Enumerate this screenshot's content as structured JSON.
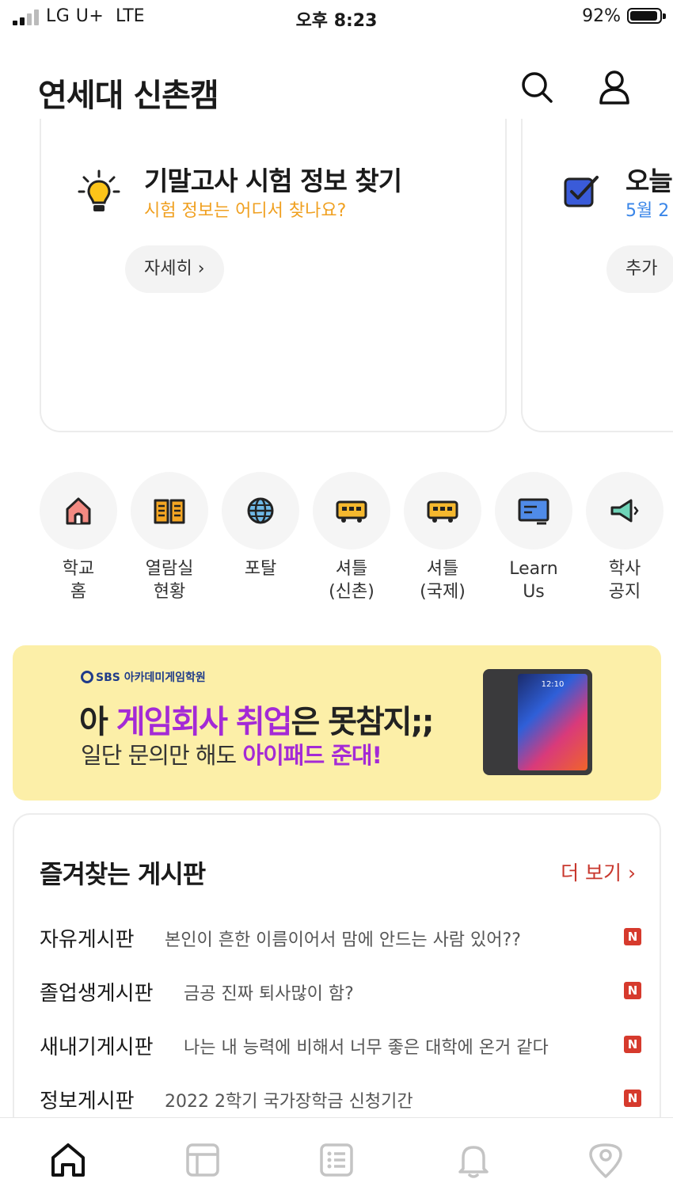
{
  "status_bar": {
    "carrier": "LG U+",
    "network": "LTE",
    "time": "오후 8:23",
    "battery": "92%"
  },
  "header": {
    "title": "연세대 신촌캠"
  },
  "cards": [
    {
      "icon": "lightbulb-icon",
      "title": "기말고사 시험 정보 찾기",
      "subtitle": "시험 정보는 어디서 찾나요?",
      "button": "자세히 ›",
      "subtitle_color": "#f0a020"
    },
    {
      "icon": "checkbox-icon",
      "title": "오늘",
      "subtitle": "5월 2",
      "button": "추가",
      "subtitle_color": "#3a86e8"
    }
  ],
  "quick_menu": [
    {
      "label": "학교\n홈",
      "icon": "house-icon"
    },
    {
      "label": "열람실\n현황",
      "icon": "book-icon"
    },
    {
      "label": "포탈",
      "icon": "globe-icon"
    },
    {
      "label": "셔틀\n(신촌)",
      "icon": "bus-icon"
    },
    {
      "label": "셔틀\n(국제)",
      "icon": "bus-icon"
    },
    {
      "label": "Learn\nUs",
      "icon": "board-icon"
    },
    {
      "label": "학사\n공지",
      "icon": "megaphone-icon"
    }
  ],
  "banner": {
    "logo": "SBS 아카데미게임학원",
    "line1_a": "아 ",
    "line1_hl": "게임회사 취업",
    "line1_b": "은 못참지;;",
    "line2_a": "일단 문의만 해도 ",
    "line2_hl": "아이패드 준대!",
    "device_time": "12:10"
  },
  "favorites": {
    "title": "즐겨찾는 게시판",
    "more": "더 보기 ›",
    "new_badge": "N",
    "rows": [
      {
        "board": "자유게시판",
        "post": "본인이 흔한 이름이어서 맘에 안드는 사람 있어??"
      },
      {
        "board": "졸업생게시판",
        "post": "금공 진짜 퇴사많이 함?"
      },
      {
        "board": "새내기게시판",
        "post": "나는 내 능력에 비해서 너무 좋은 대학에 온거 같다"
      },
      {
        "board": "정보게시판",
        "post": "2022 2학기 국가장학금 신청기간"
      }
    ]
  },
  "tab_bar": [
    {
      "icon": "home-icon",
      "active": true
    },
    {
      "icon": "timetable-icon",
      "active": false
    },
    {
      "icon": "list-icon",
      "active": false
    },
    {
      "icon": "bell-icon",
      "active": false
    },
    {
      "icon": "campus-pick-icon",
      "active": false
    }
  ],
  "colors": {
    "accent": "#c8372d",
    "new_badge": "#d63a2d",
    "banner_bg": "#fcefa8",
    "banner_highlight": "#a42ad6"
  }
}
